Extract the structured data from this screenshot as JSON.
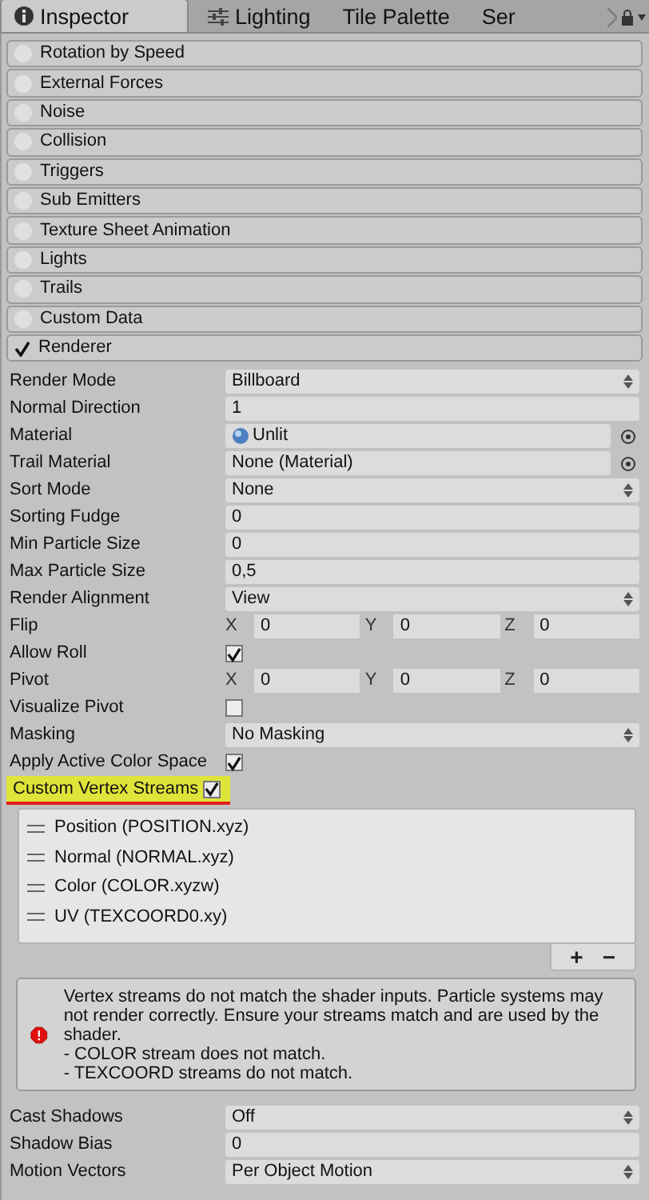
{
  "tabs": [
    {
      "label": "Inspector",
      "selected": true
    },
    {
      "label": "Lighting",
      "selected": false
    },
    {
      "label": "Tile Palette",
      "selected": false
    },
    {
      "label": "Ser",
      "selected": false
    }
  ],
  "modules": [
    {
      "label": "Rotation by Speed",
      "enabled": false
    },
    {
      "label": "External Forces",
      "enabled": false
    },
    {
      "label": "Noise",
      "enabled": false
    },
    {
      "label": "Collision",
      "enabled": false
    },
    {
      "label": "Triggers",
      "enabled": false
    },
    {
      "label": "Sub Emitters",
      "enabled": false
    },
    {
      "label": "Texture Sheet Animation",
      "enabled": false
    },
    {
      "label": "Lights",
      "enabled": false
    },
    {
      "label": "Trails",
      "enabled": false
    },
    {
      "label": "Custom Data",
      "enabled": false
    },
    {
      "label": "Renderer",
      "enabled": true
    }
  ],
  "properties": [
    {
      "kind": "dropdown",
      "label": "Render Mode",
      "value": "Billboard"
    },
    {
      "kind": "field",
      "label": "Normal Direction",
      "value": "1"
    },
    {
      "kind": "asset",
      "label": "Material",
      "value": "Unlit"
    },
    {
      "kind": "object",
      "label": "Trail Material",
      "value": "None (Material)"
    },
    {
      "kind": "dropdown",
      "label": "Sort Mode",
      "value": "None"
    },
    {
      "kind": "field",
      "label": "Sorting Fudge",
      "value": "0"
    },
    {
      "kind": "field",
      "label": "Min Particle Size",
      "value": "0"
    },
    {
      "kind": "field",
      "label": "Max Particle Size",
      "value": "0,5"
    },
    {
      "kind": "dropdown",
      "label": "Render Alignment",
      "value": "View"
    },
    {
      "kind": "vector",
      "label": "Flip",
      "components": [
        {
          "axis": "X",
          "value": "0"
        },
        {
          "axis": "Y",
          "value": "0"
        },
        {
          "axis": "Z",
          "value": "0"
        }
      ]
    },
    {
      "kind": "checkbox",
      "label": "Allow Roll",
      "checked": true
    },
    {
      "kind": "vector",
      "label": "Pivot",
      "components": [
        {
          "axis": "X",
          "value": "0"
        },
        {
          "axis": "Y",
          "value": "0"
        },
        {
          "axis": "Z",
          "value": "0"
        }
      ]
    },
    {
      "kind": "checkbox",
      "label": "Visualize Pivot",
      "checked": false
    },
    {
      "kind": "dropdown",
      "label": "Masking",
      "value": "No Masking"
    },
    {
      "kind": "checkbox",
      "label": "Apply Active Color Space",
      "checked": true
    },
    {
      "kind": "checkbox",
      "label": "Custom Vertex Streams",
      "checked": true,
      "highlighted": true
    }
  ],
  "streams": [
    "Position (POSITION.xyz)",
    "Normal (NORMAL.xyz)",
    "Color (COLOR.xyzw)",
    "UV (TEXCOORD0.xy)"
  ],
  "list_buttons": [
    "+",
    "−"
  ],
  "help": {
    "kind": "error",
    "text": "Vertex streams do not match the shader inputs. Particle systems may not render correctly. Ensure your streams match and are used by the shader.\n- COLOR stream does not match.\n- TEXCOORD streams do not match."
  },
  "more_properties": [
    {
      "kind": "dropdown",
      "label": "Cast Shadows",
      "value": "Off"
    },
    {
      "kind": "field",
      "label": "Shadow Bias",
      "value": "0"
    },
    {
      "kind": "dropdown",
      "label": "Motion Vectors",
      "value": "Per Object Motion"
    }
  ]
}
